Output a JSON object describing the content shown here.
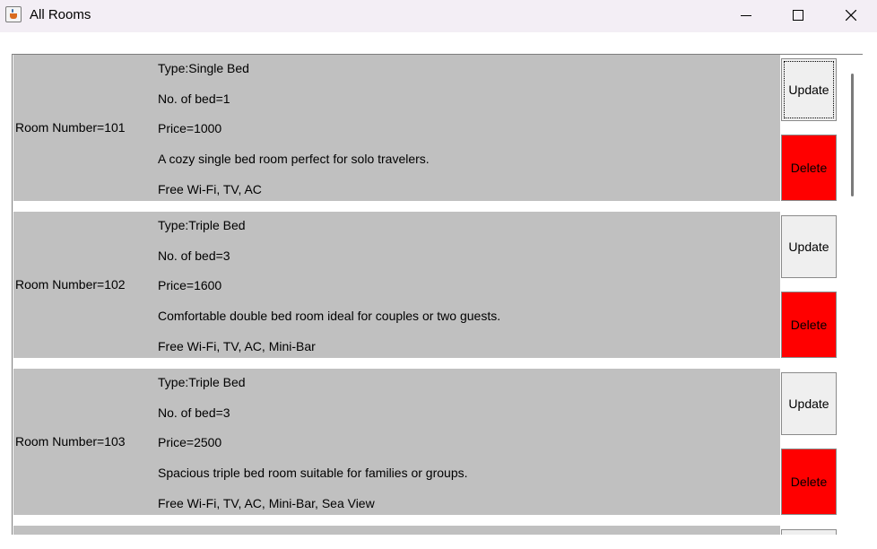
{
  "window": {
    "title": "All Rooms",
    "controls": [
      "minimize-icon",
      "maximize-icon",
      "close-icon"
    ]
  },
  "colors": {
    "row_band": "#c0c0c0",
    "delete_button": "#ff0000",
    "update_button": "#efefef",
    "titlebar": "#f3eef5"
  },
  "rooms": [
    {
      "room_label": "Room Number=101",
      "details": [
        "Type:Single Bed",
        "No. of bed=1",
        "Price=1000",
        "A cozy single bed room perfect for solo travelers.",
        "Free Wi-Fi, TV, AC"
      ],
      "update_label": "Update",
      "delete_label": "Delete"
    },
    {
      "room_label": "Room Number=102",
      "details": [
        "Type:Triple Bed",
        "No. of bed=3",
        "Price=1600",
        "Comfortable double bed room ideal for couples or two guests.",
        "Free Wi-Fi, TV, AC, Mini-Bar"
      ],
      "update_label": "Update",
      "delete_label": "Delete"
    },
    {
      "room_label": "Room Number=103",
      "details": [
        "Type:Triple Bed",
        "No. of bed=3",
        "Price=2500",
        "Spacious triple bed room suitable for families or groups.",
        "Free Wi-Fi, TV, AC, Mini-Bar, Sea View"
      ],
      "update_label": "Update",
      "delete_label": "Delete"
    }
  ]
}
